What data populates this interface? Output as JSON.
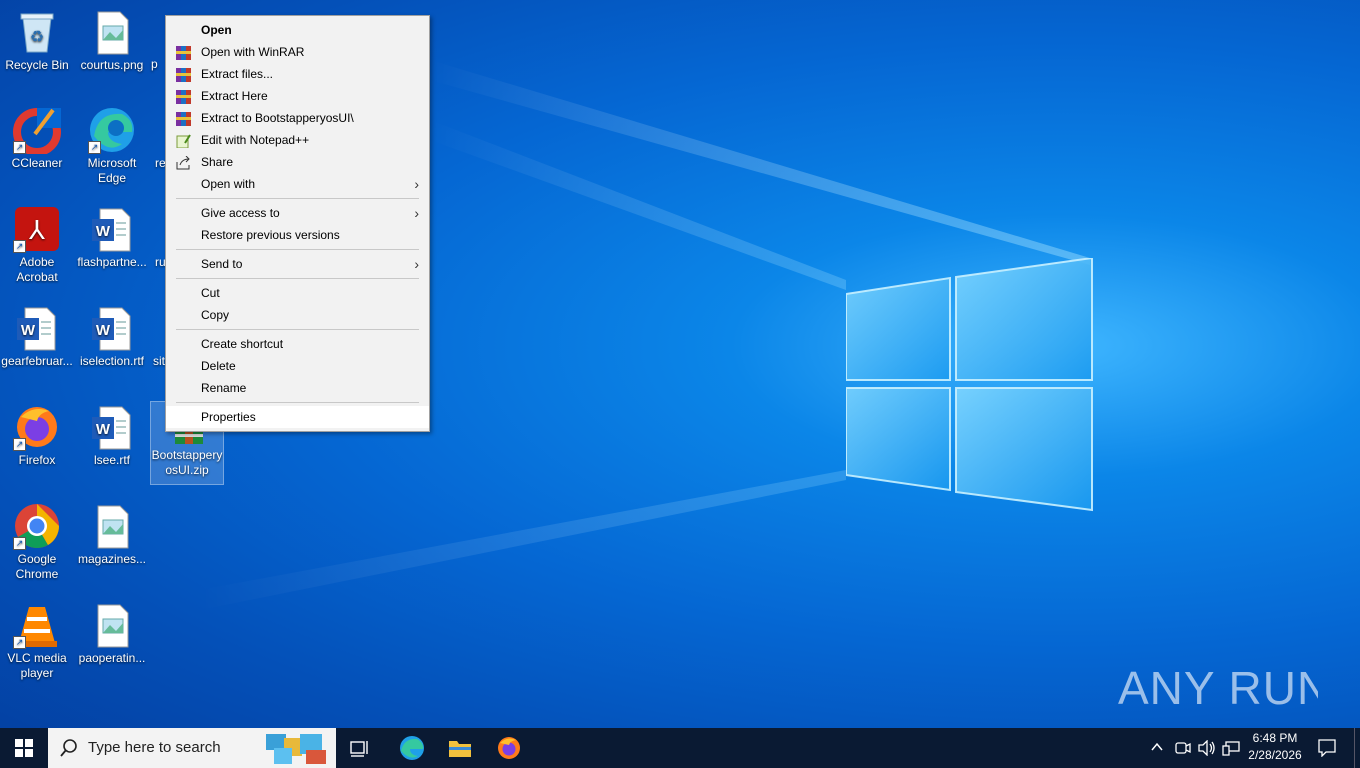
{
  "desktop": {
    "icons": [
      {
        "label": "Recycle Bin"
      },
      {
        "label": "courtus.png"
      },
      {
        "label": "CCleaner"
      },
      {
        "label": "Microsoft Edge"
      },
      {
        "label": "Adobe Acrobat"
      },
      {
        "label": "flashpartne..."
      },
      {
        "label": "gearfebruar..."
      },
      {
        "label": "iselection.rtf"
      },
      {
        "label": "Firefox"
      },
      {
        "label": "lsee.rtf"
      },
      {
        "label": "Google Chrome"
      },
      {
        "label": "magazines..."
      },
      {
        "label": "VLC media player"
      },
      {
        "label": "paoperatin..."
      },
      {
        "label": "BootstapperyosUI.zip"
      }
    ],
    "partial_labels": [
      "p",
      "re",
      "ru",
      "sit"
    ]
  },
  "context_menu": {
    "items": [
      {
        "label": "Open"
      },
      {
        "label": "Open with WinRAR"
      },
      {
        "label": "Extract files..."
      },
      {
        "label": "Extract Here"
      },
      {
        "label": "Extract to BootstapperyosUI\\"
      },
      {
        "label": "Edit with Notepad++"
      },
      {
        "label": "Share"
      },
      {
        "label": "Open with"
      },
      {
        "label": "Give access to"
      },
      {
        "label": "Restore previous versions"
      },
      {
        "label": "Send to"
      },
      {
        "label": "Cut"
      },
      {
        "label": "Copy"
      },
      {
        "label": "Create shortcut"
      },
      {
        "label": "Delete"
      },
      {
        "label": "Rename"
      },
      {
        "label": "Properties"
      }
    ]
  },
  "taskbar": {
    "search_placeholder": "Type here to search",
    "time": "6:48 PM",
    "date": "2/28/2026"
  },
  "watermark": "ANY RUN",
  "colors": {
    "desktop_blue": "#0567d3",
    "taskbar": "#0a1a33",
    "menu_bg": "#f2f2f2"
  }
}
